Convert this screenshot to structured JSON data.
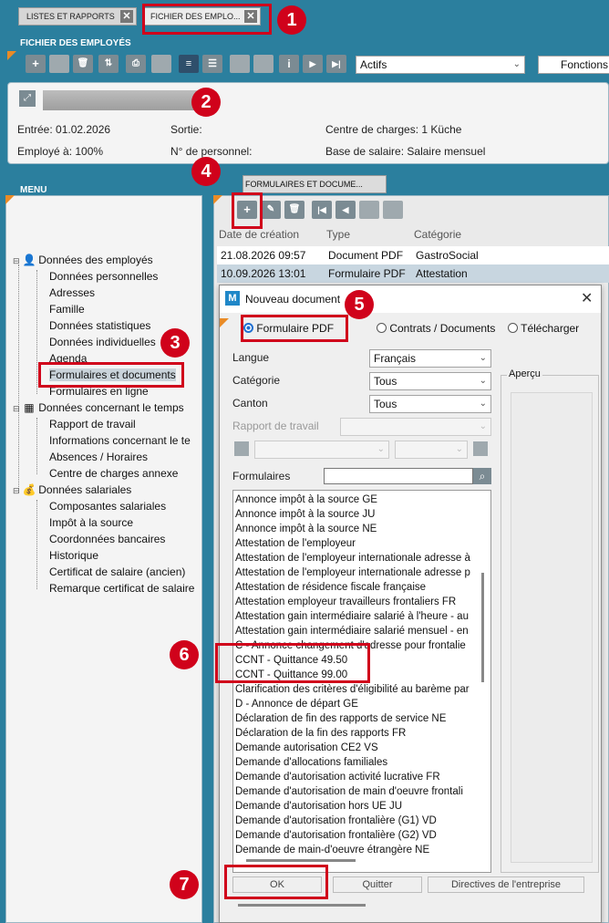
{
  "tabs": [
    {
      "label": "LISTES ET RAPPORTS"
    },
    {
      "label": "FICHIER DES EMPLO..."
    }
  ],
  "section": {
    "title": "FICHIER DES EMPLOYÉS"
  },
  "toolbar": {
    "status_value": "Actifs",
    "fonctions_label": "Fonctions"
  },
  "employee": {
    "entree": "Entrée: 01.02.2026",
    "sortie": "Sortie:",
    "centre": "Centre de charges: 1 Küche",
    "employe": "Employé à: 100%",
    "numero": "N° de personnel:",
    "base": "Base de salaire: Salaire mensuel"
  },
  "menu": {
    "title": "MENU",
    "groups": [
      {
        "label": "Données des employés",
        "items": [
          "Données personnelles",
          "Adresses",
          "Famille",
          "Données statistiques",
          "Données individuelles",
          "Agenda",
          "Formulaires et documents",
          "Formulaires en ligne"
        ]
      },
      {
        "label": "Données concernant le temps",
        "items": [
          "Rapport de travail",
          "Informations concernant le te",
          "Absences / Horaires",
          "Centre de charges annexe"
        ]
      },
      {
        "label": "Données salariales",
        "items": [
          "Composantes salariales",
          "Impôt à la source",
          "Coordonnées bancaires",
          "Historique",
          "Certificat de salaire (ancien)",
          "Remarque certificat de salaire"
        ]
      }
    ]
  },
  "forms_panel": {
    "tab": "FORMULAIRES ET DOCUME...",
    "columns": [
      "Date de création",
      "Type",
      "Catégorie"
    ],
    "rows": [
      {
        "date": "21.08.2026 09:57",
        "type": "Document PDF",
        "cat": "GastroSocial"
      },
      {
        "date": "10.09.2026 13:01",
        "type": "Formulaire PDF",
        "cat": "Attestation"
      }
    ]
  },
  "dialog": {
    "title": "Nouveau document",
    "radios": [
      "Formulaire PDF",
      "Contrats / Documents",
      "Télécharger"
    ],
    "langue_label": "Langue",
    "langue_value": "Français",
    "categorie_label": "Catégorie",
    "categorie_value": "Tous",
    "canton_label": "Canton",
    "canton_value": "Tous",
    "rapport_label": "Rapport de travail",
    "formulaires_label": "Formulaires",
    "apercu_label": "Aperçu",
    "list": [
      "Annonce impôt à la source  GE",
      "Annonce impôt à la source  JU",
      "Annonce impôt à la source  NE",
      "Attestation de l'employeur",
      "Attestation de l'employeur internationale adresse à",
      "Attestation de l'employeur internationale adresse p",
      "Attestation de résidence fiscale française",
      "Attestation employeur travailleurs frontaliers FR",
      "Attestation gain intermédiaire salarié à l'heure - au",
      "Attestation gain intermédiaire salarié mensuel - en",
      "C - Annonce changement d'adresse pour frontalie",
      "CCNT - Quittance 49.50",
      "CCNT - Quittance 99.00",
      "Clarification des critères d'éligibilité au barème par",
      "D - Annonce de départ GE",
      "Déclaration de fin des rapports de service NE",
      "Déclaration de la fin des rapports FR",
      "Demande autorisation CE2 VS",
      "Demande d'allocations familiales",
      "Demande d'autorisation activité lucrative FR",
      "Demande d'autorisation de main d'oeuvre frontali",
      "Demande d'autorisation hors UE JU",
      "Demande d'autorisation frontalière (G1) VD",
      "Demande d'autorisation frontalière (G2) VD",
      "Demande de main-d'oeuvre étrangère NE"
    ],
    "ok": "OK",
    "quitter": "Quitter",
    "directives": "Directives de l'entreprise"
  },
  "badges": [
    "1",
    "2",
    "3",
    "4",
    "5",
    "6",
    "7"
  ],
  "colors": {
    "accent": "#e98b26",
    "highlight": "#d0021b",
    "background": "#2b7f9e"
  }
}
